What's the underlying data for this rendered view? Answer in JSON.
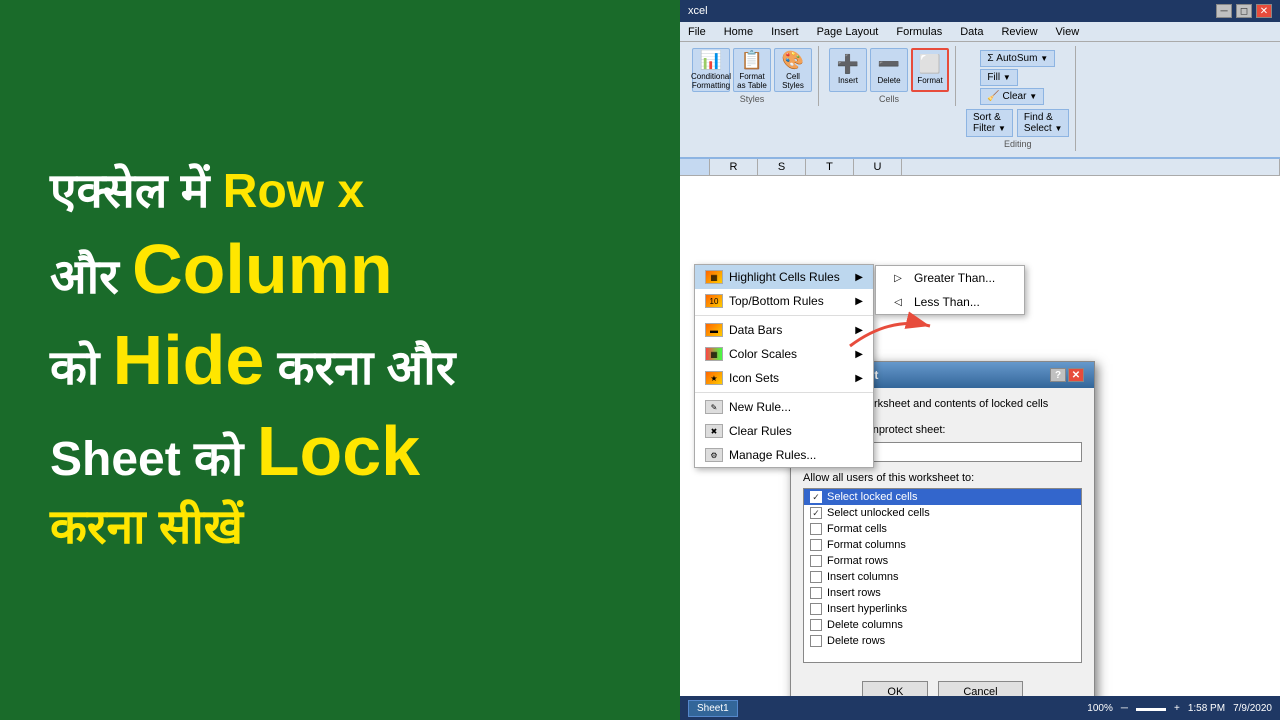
{
  "leftPanel": {
    "line1": "एक्सेल में",
    "line1_yellow": "Row x",
    "line2": "और",
    "line2_yellow": "Column",
    "line3": "को",
    "line3_yellow": "Hide",
    "line3b": "करना और",
    "line4": "Sheet को",
    "line4_yellow": "Lock",
    "line5": "करना सीखें"
  },
  "ribbon": {
    "tabs": [
      "File",
      "Home",
      "Insert",
      "Page Layout",
      "Formulas",
      "Data",
      "Review",
      "View"
    ],
    "activeTab": "Home",
    "groups": {
      "conditionalFormatting": "Conditional\nFormatting",
      "formatAsTable": "Format\nas Table",
      "cellStyles": "Cell\nStyles",
      "insert": "Insert",
      "delete": "Delete",
      "format": "Format",
      "autoSum": "AutoSum",
      "fill": "Fill",
      "clear": "Clear",
      "sortFilter": "Sort &\nFilter",
      "findSelect": "Find &\nSelect"
    },
    "editingLabel": "Editing"
  },
  "dropdown": {
    "items": [
      {
        "label": "Highlight Cells Rules",
        "hasArrow": true,
        "active": true
      },
      {
        "label": "Top/Bottom Rules",
        "hasArrow": true
      },
      {
        "label": "Data Bars",
        "hasArrow": true
      },
      {
        "label": "Color Scales",
        "hasArrow": true
      },
      {
        "label": "Icon Sets",
        "hasArrow": true
      },
      {
        "label": "New Rule..."
      },
      {
        "label": "Clear Rules"
      },
      {
        "label": "Manage Rules..."
      }
    ],
    "subItems": [
      {
        "label": "Greater Than..."
      },
      {
        "label": "Less Than..."
      }
    ]
  },
  "dialog": {
    "title": "Protect Sheet",
    "checkboxLabel": "Protect worksheet and contents of locked cells",
    "passwordLabel": "Password to unprotect sheet:",
    "allowLabel": "Allow all users of this worksheet to:",
    "listItems": [
      {
        "label": "Select locked cells",
        "checked": true,
        "selected": true
      },
      {
        "label": "Select unlocked cells",
        "checked": true,
        "selected": false
      },
      {
        "label": "Format cells",
        "checked": false,
        "selected": false
      },
      {
        "label": "Format columns",
        "checked": false,
        "selected": false
      },
      {
        "label": "Format rows",
        "checked": false,
        "selected": false
      },
      {
        "label": "Insert columns",
        "checked": false,
        "selected": false
      },
      {
        "label": "Insert rows",
        "checked": false,
        "selected": false
      },
      {
        "label": "Insert hyperlinks",
        "checked": false,
        "selected": false
      },
      {
        "label": "Delete columns",
        "checked": false,
        "selected": false
      },
      {
        "label": "Delete rows",
        "checked": false,
        "selected": false
      }
    ],
    "okLabel": "OK",
    "cancelLabel": "Cancel"
  },
  "statusBar": {
    "sheetTab": "Sheet1",
    "zoom": "100%",
    "time": "1:58 PM",
    "date": "7/9/2020"
  },
  "columns": [
    "R",
    "S",
    "T",
    "U"
  ],
  "formatHighlight": "Format"
}
